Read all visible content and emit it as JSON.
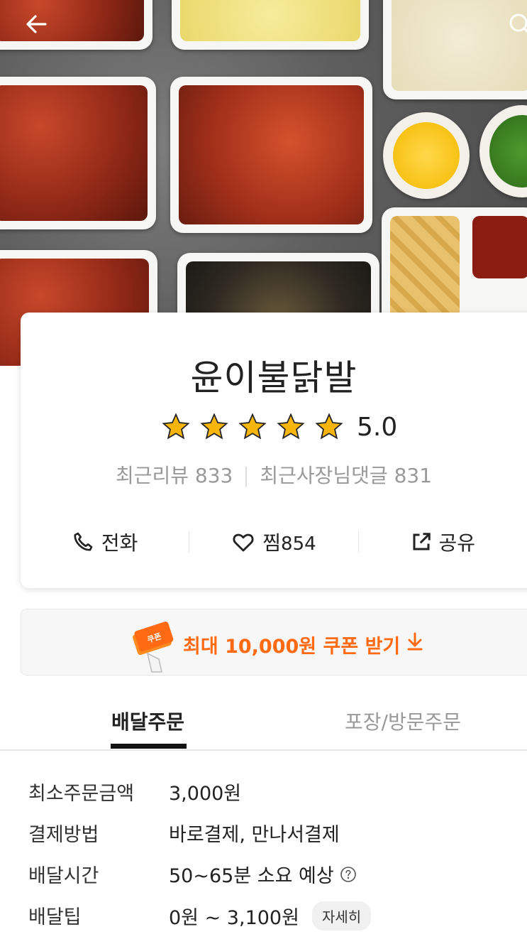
{
  "store": {
    "name": "윤이불닭발",
    "rating": "5.0",
    "stars": 5,
    "recent_reviews": "최근리뷰 833",
    "owner_replies": "최근사장님댓글 831"
  },
  "actions": {
    "call": "전화",
    "favorite": "찜",
    "favorite_count": "854",
    "share": "공유"
  },
  "coupon": {
    "label": "최대 10,000원 쿠폰 받기",
    "icon_text": "쿠폰"
  },
  "tabs": {
    "delivery": "배달주문",
    "pickup": "포장/방문주문"
  },
  "details": [
    {
      "label": "최소주문금액",
      "value": "3,000원"
    },
    {
      "label": "결제방법",
      "value": "바로결제, 만나서결제"
    },
    {
      "label": "배달시간",
      "value": "50~65분 소요 예상"
    },
    {
      "label": "배달팁",
      "value": "0원 ~ 3,100원",
      "button": "자세히"
    }
  ],
  "colors": {
    "accent": "#ff6a13",
    "star": "#f5b50a"
  }
}
